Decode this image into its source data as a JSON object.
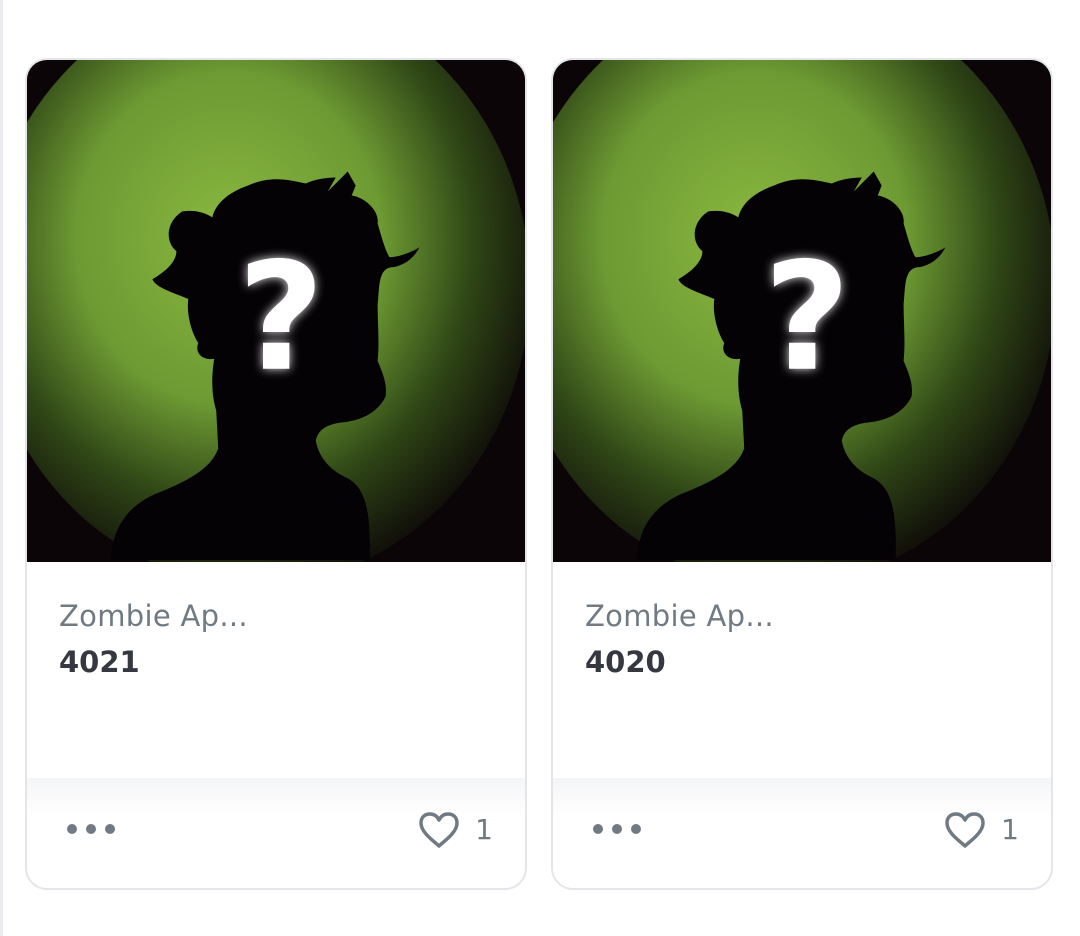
{
  "cards": [
    {
      "collection": "Zombie Ap...",
      "token_id": "4021",
      "favorites": "1",
      "image_icon": "unrevealed-silhouette-question-mark",
      "more_icon": "ellipsis-icon",
      "favorite_icon": "heart-outline-icon"
    },
    {
      "collection": "Zombie Ap...",
      "token_id": "4020",
      "favorites": "1",
      "image_icon": "unrevealed-silhouette-question-mark",
      "more_icon": "ellipsis-icon",
      "favorite_icon": "heart-outline-icon"
    }
  ],
  "colors": {
    "glow": "#7ba839",
    "background": "#0b0507",
    "text_secondary": "#707a83",
    "text_primary": "#353840",
    "border": "#e3e5e8"
  }
}
